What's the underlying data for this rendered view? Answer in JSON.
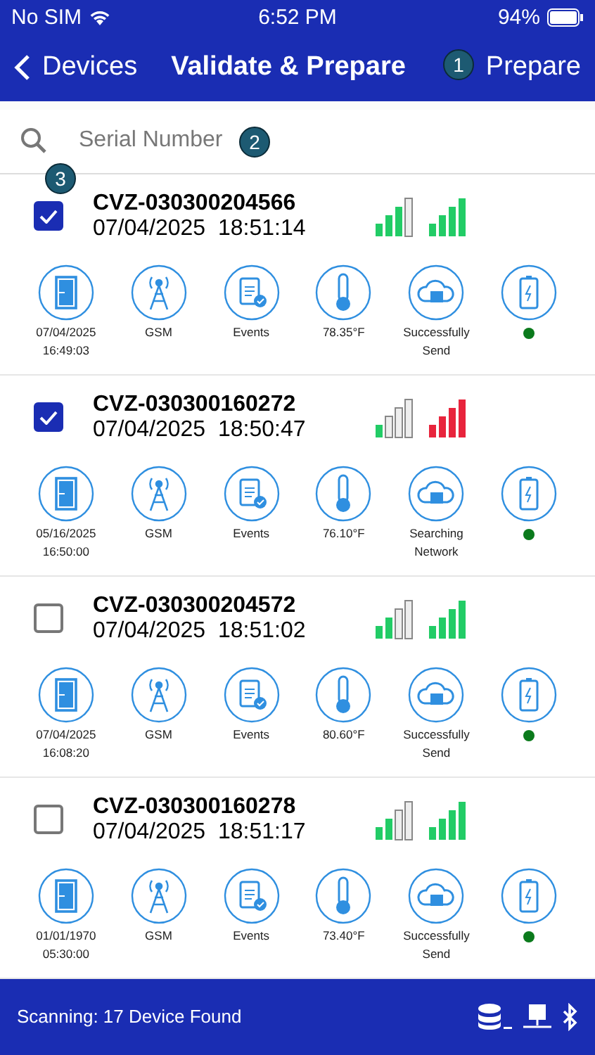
{
  "status_bar": {
    "carrier": "No SIM",
    "time": "6:52 PM",
    "battery": "94%"
  },
  "nav": {
    "back": "Devices",
    "title": "Validate & Prepare",
    "action": "Prepare"
  },
  "search": {
    "placeholder": "Serial Number"
  },
  "callouts": [
    {
      "text": "1",
      "kind": "action"
    },
    {
      "text": "2",
      "kind": "search"
    },
    {
      "text": "3",
      "kind": "checkbox"
    }
  ],
  "devices": [
    {
      "serial": "CVZ-030300204566",
      "timestamp": "07/04/2025  18:51:14",
      "checked": true,
      "signals": [
        {
          "kind": "strong",
          "color": "#22cc66"
        },
        {
          "kind": "full",
          "color": "#22cc66"
        }
      ],
      "sensors": [
        {
          "kind": "door",
          "label": "07/04/2025\n16:49:03"
        },
        {
          "kind": "gsm",
          "label": "GSM"
        },
        {
          "kind": "events",
          "label": "Events"
        },
        {
          "kind": "temp",
          "label": "78.35°F"
        },
        {
          "kind": "cloud",
          "label": "Successfully\nSend"
        },
        {
          "kind": "battery",
          "color": "#0b7a1c"
        }
      ]
    },
    {
      "serial": "CVZ-030300160272",
      "timestamp": "07/04/2025  18:50:47",
      "checked": true,
      "signals": [
        {
          "kind": "weak",
          "color": "#22cc66"
        },
        {
          "kind": "full",
          "color": "#e8243c"
        }
      ],
      "sensors": [
        {
          "kind": "door",
          "label": "05/16/2025\n16:50:00"
        },
        {
          "kind": "gsm",
          "label": "GSM"
        },
        {
          "kind": "events",
          "label": "Events"
        },
        {
          "kind": "temp",
          "label": "76.10°F"
        },
        {
          "kind": "cloud",
          "label": "Searching\nNetwork"
        },
        {
          "kind": "battery",
          "color": "#0b7a1c"
        }
      ]
    },
    {
      "serial": "CVZ-030300204572",
      "timestamp": "07/04/2025  18:51:02",
      "checked": false,
      "signals": [
        {
          "kind": "medium",
          "color": "#22cc66"
        },
        {
          "kind": "full",
          "color": "#22cc66"
        }
      ],
      "sensors": [
        {
          "kind": "door",
          "label": "07/04/2025\n16:08:20"
        },
        {
          "kind": "gsm",
          "label": "GSM"
        },
        {
          "kind": "events",
          "label": "Events"
        },
        {
          "kind": "temp",
          "label": "80.60°F"
        },
        {
          "kind": "cloud",
          "label": "Successfully\nSend"
        },
        {
          "kind": "battery",
          "color": "#0b7a1c"
        }
      ]
    },
    {
      "serial": "CVZ-030300160278",
      "timestamp": "07/04/2025  18:51:17",
      "checked": false,
      "signals": [
        {
          "kind": "medium",
          "color": "#22cc66"
        },
        {
          "kind": "full",
          "color": "#22cc66"
        }
      ],
      "sensors": [
        {
          "kind": "door",
          "label": "01/01/1970\n05:30:00"
        },
        {
          "kind": "gsm",
          "label": "GSM"
        },
        {
          "kind": "events",
          "label": "Events"
        },
        {
          "kind": "temp",
          "label": "73.40°F"
        },
        {
          "kind": "cloud",
          "label": "Successfully\nSend"
        },
        {
          "kind": "battery",
          "color": "#0b7a1c"
        }
      ]
    }
  ],
  "footer": {
    "status": "Scanning: 17 Device Found"
  }
}
